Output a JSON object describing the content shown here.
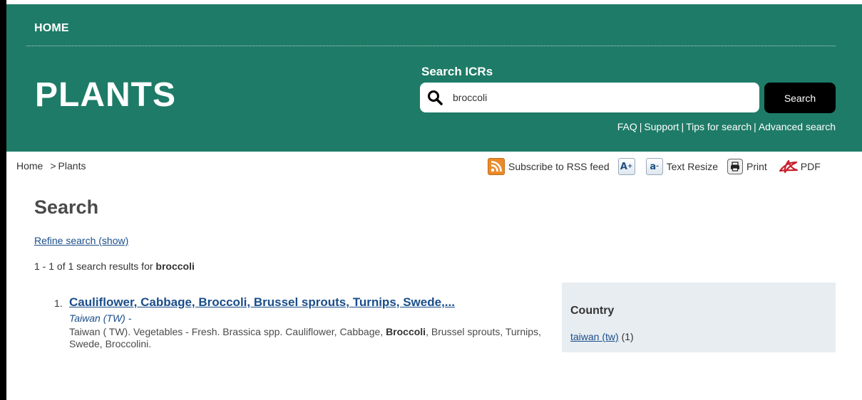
{
  "header": {
    "nav_home": "HOME",
    "site_title": "PLANTS",
    "search_label": "Search ICRs",
    "search_value": "broccoli",
    "search_button": "Search",
    "help_links": [
      "FAQ",
      "Support",
      "Tips for search",
      "Advanced search"
    ],
    "help_separator": "|"
  },
  "breadcrumb": {
    "home": "Home",
    "separator": ">",
    "current": "Plants"
  },
  "tools": {
    "rss": "Subscribe to RSS feed",
    "text_increase_glyph": "A+",
    "text_decrease_glyph": "a-",
    "text_resize": "Text Resize",
    "print": "Print",
    "pdf": "PDF"
  },
  "main": {
    "title": "Search",
    "refine_link": "Refine search (show)",
    "summary_prefix": "1 - 1 of 1 search results for ",
    "summary_query": "broccoli"
  },
  "results": [
    {
      "number": "1.",
      "title": "Cauliflower, Cabbage, Broccoli, Brussel sprouts, Turnips, Swede,...",
      "source": "Taiwan (TW) -",
      "desc_before": "Taiwan ( TW). Vegetables - Fresh. Brassica spp. Cauliflower, Cabbage, ",
      "desc_highlight": "Broccoli",
      "desc_after": ", Brussel sprouts, Turnips, Swede, Broccolini."
    }
  ],
  "facet": {
    "heading": "Country",
    "items": [
      {
        "label": "taiwan (tw)",
        "count": "(1)"
      }
    ]
  },
  "colors": {
    "header_bg": "#1e7b67",
    "link": "#1a4e8a",
    "facet_bg": "#e8edf1",
    "search_button_bg": "#000000"
  },
  "icons": [
    "search-icon",
    "rss-icon",
    "text-increase-icon",
    "text-decrease-icon",
    "print-icon",
    "pdf-icon"
  ]
}
